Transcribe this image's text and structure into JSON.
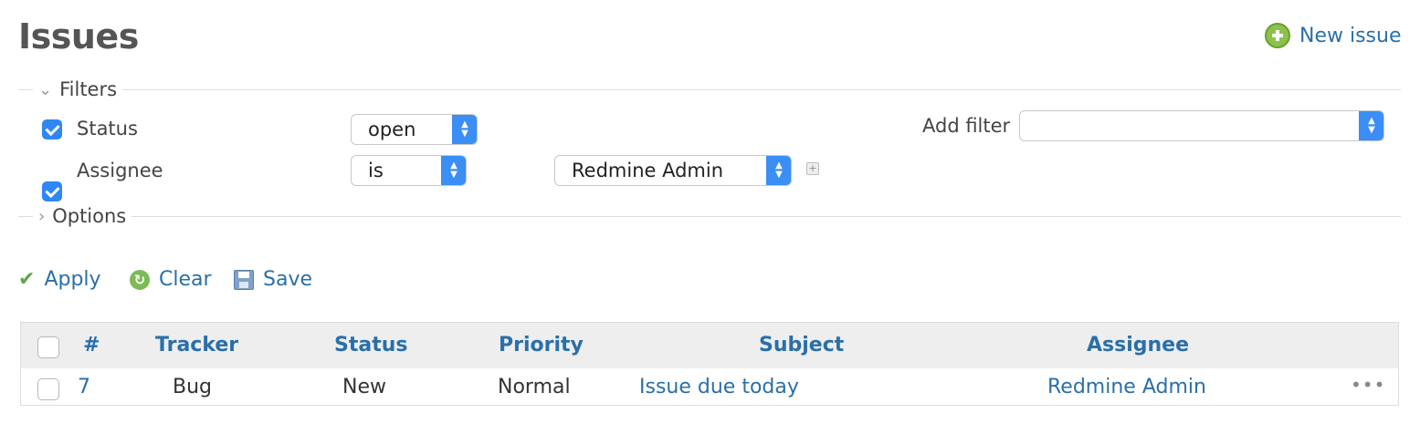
{
  "page": {
    "title": "Issues",
    "new_issue": "New issue"
  },
  "filters": {
    "legend": "Filters",
    "status": {
      "label": "Status",
      "operator": "open"
    },
    "assignee": {
      "label": "Assignee",
      "operator": "is",
      "value": "Redmine Admin"
    },
    "add_filter_label": "Add filter",
    "add_filter_value": ""
  },
  "options": {
    "legend": "Options"
  },
  "actions": {
    "apply": "Apply",
    "clear": "Clear",
    "save": "Save"
  },
  "table": {
    "columns": [
      "#",
      "Tracker",
      "Status",
      "Priority",
      "Subject",
      "Assignee"
    ],
    "rows": [
      {
        "id": "7",
        "tracker": "Bug",
        "status": "New",
        "priority": "Normal",
        "subject": "Issue due today",
        "assignee": "Redmine Admin"
      }
    ]
  },
  "icons": {
    "new_issue": "plus-circle-icon",
    "filters": "chevron-down-icon",
    "options": "chevron-right-icon",
    "apply": "checkmark-icon",
    "clear": "reload-icon",
    "save": "save-icon",
    "row_menu": "more-icon"
  },
  "colors": {
    "link": "#2a6fa8",
    "checkbox": "#2f86f6",
    "select_arrow": "#3a8ef5",
    "header_bg": "#eeeeee"
  }
}
